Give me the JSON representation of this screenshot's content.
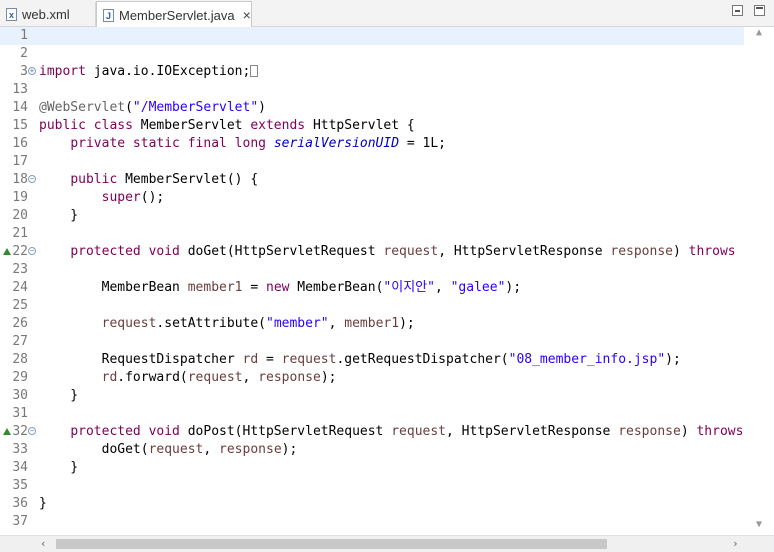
{
  "tabs": [
    {
      "label": "web.xml",
      "icon": "xml-file-icon"
    },
    {
      "label": "MemberServlet.java",
      "icon": "java-file-icon",
      "close": "×"
    }
  ],
  "lines": [
    {
      "n": "1",
      "html": ""
    },
    {
      "n": "2",
      "html": ""
    },
    {
      "n": "3",
      "html": "<span class=\"kw\">import</span> java.io.IOException;<span class=\"fbox\"></span>"
    },
    {
      "n": "13",
      "html": ""
    },
    {
      "n": "14",
      "html": "<span class=\"ann\">@WebServlet</span>(<span class=\"str\">\"/MemberServlet\"</span>)"
    },
    {
      "n": "15",
      "html": "<span class=\"kw\">public class</span> MemberServlet <span class=\"kw\">extends</span> HttpServlet {"
    },
    {
      "n": "16",
      "html": "    <span class=\"kw\">private static final long</span> <span class=\"fld\">serialVersionUID</span> = 1L;"
    },
    {
      "n": "17",
      "html": ""
    },
    {
      "n": "18",
      "html": "    <span class=\"kw\">public</span> MemberServlet() {"
    },
    {
      "n": "19",
      "html": "        <span class=\"kw\">super</span>();"
    },
    {
      "n": "20",
      "html": "    }"
    },
    {
      "n": "21",
      "html": ""
    },
    {
      "n": "22",
      "html": "    <span class=\"kw\">protected void</span> doGet(HttpServletRequest <span class=\"par\">request</span>, HttpServletResponse <span class=\"par\">response</span>) <span class=\"kw\">throws</span> ServletExce"
    },
    {
      "n": "23",
      "html": ""
    },
    {
      "n": "24",
      "html": "        MemberBean <span class=\"par\">member1</span> = <span class=\"kw\">new</span> MemberBean(<span class=\"str\">\"이지안\"</span>, <span class=\"str\">\"galee\"</span>);"
    },
    {
      "n": "25",
      "html": ""
    },
    {
      "n": "26",
      "html": "        <span class=\"par\">request</span>.setAttribute(<span class=\"str\">\"member\"</span>, <span class=\"par\">member1</span>);"
    },
    {
      "n": "27",
      "html": ""
    },
    {
      "n": "28",
      "html": "        RequestDispatcher <span class=\"par\">rd</span> = <span class=\"par\">request</span>.getRequestDispatcher(<span class=\"str\">\"08_member_info.jsp\"</span>);"
    },
    {
      "n": "29",
      "html": "        <span class=\"par\">rd</span>.forward(<span class=\"par\">request</span>, <span class=\"par\">response</span>);"
    },
    {
      "n": "30",
      "html": "    }"
    },
    {
      "n": "31",
      "html": ""
    },
    {
      "n": "32",
      "html": "    <span class=\"kw\">protected void</span> doPost(HttpServletRequest <span class=\"par\">request</span>, HttpServletResponse <span class=\"par\">response</span>) <span class=\"kw\">throws</span> ServletExc"
    },
    {
      "n": "33",
      "html": "        doGet(<span class=\"par\">request</span>, <span class=\"par\">response</span>);"
    },
    {
      "n": "34",
      "html": "    }"
    },
    {
      "n": "35",
      "html": ""
    },
    {
      "n": "36",
      "html": "}"
    },
    {
      "n": "37",
      "html": ""
    }
  ],
  "markers": {
    "3": "expand",
    "18": "collapse",
    "22": "override-collapse",
    "32": "override-collapse"
  },
  "current_line": "1",
  "colors": {
    "keyword": "#7f0055",
    "string": "#2a00ff",
    "annotation": "#646464",
    "field": "#0000c0",
    "current_line_bg": "#e8f2fe"
  }
}
